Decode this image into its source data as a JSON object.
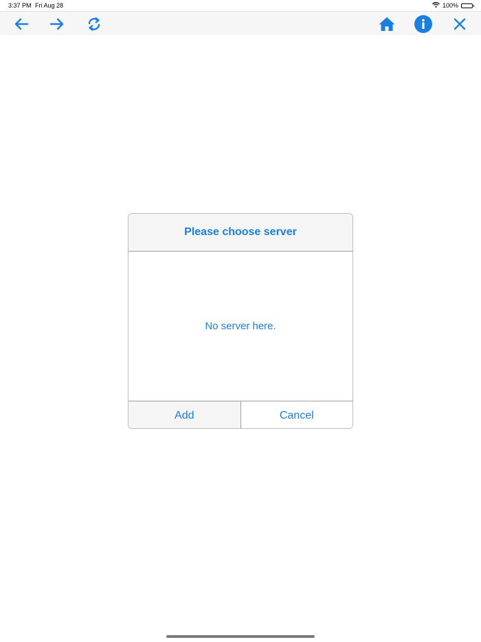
{
  "status_bar": {
    "time": "3:37 PM",
    "date": "Fri Aug 28",
    "battery": "100%",
    "wifi_icon": "wifi-icon",
    "battery_icon": "battery-icon"
  },
  "toolbar": {
    "accent_color": "#1a7fe0",
    "left_buttons": [
      "back-arrow-icon",
      "forward-arrow-icon",
      "refresh-icon"
    ],
    "right_buttons": [
      "home-icon",
      "info-icon",
      "close-icon"
    ]
  },
  "dialog": {
    "title": "Please choose server",
    "empty_message": "No server here.",
    "add_label": "Add",
    "cancel_label": "Cancel"
  }
}
